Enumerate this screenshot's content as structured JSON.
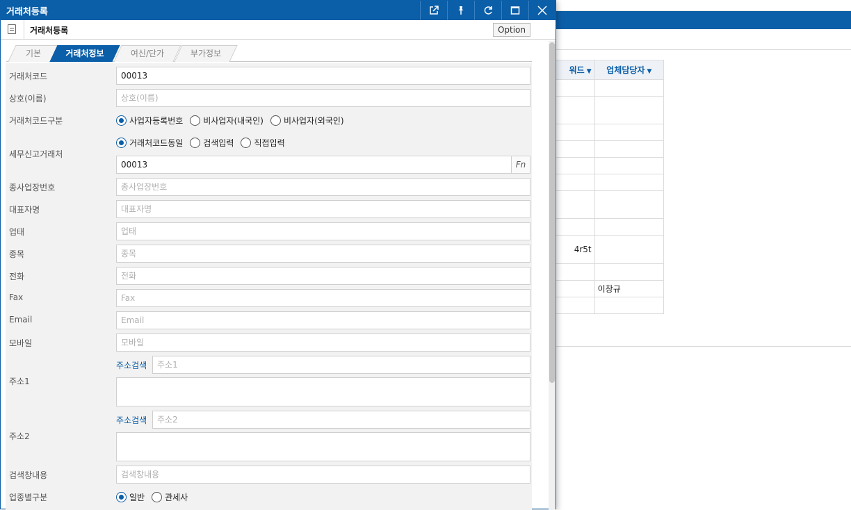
{
  "background": {
    "grid_headers": [
      "워드",
      "업체담당자"
    ],
    "grid_cells": [
      "4r5t",
      "이창규"
    ]
  },
  "dialog": {
    "title": "거래처등록",
    "header_title": "거래처등록",
    "option_label": "Option",
    "icons": [
      "popout-icon",
      "pin-icon",
      "refresh-icon",
      "maximize-icon",
      "close-icon"
    ]
  },
  "tabs": [
    "기본",
    "거래처정보",
    "여신/단가",
    "부가정보"
  ],
  "active_tab": 1,
  "form": {
    "code_label": "거래처코드",
    "code_value": "00013",
    "name_label": "상호(이름)",
    "name_placeholder": "상호(이름)",
    "code_type_label": "거래처코드구분",
    "code_type_options": [
      "사업자등록번호",
      "비사업자(내국인)",
      "비사업자(외국인)"
    ],
    "tax_label": "세무신고거래처",
    "tax_options": [
      "거래처코드동일",
      "검색입력",
      "직접입력"
    ],
    "tax_value": "00013",
    "fn_label": "Fn",
    "branch_label": "종사업장번호",
    "branch_placeholder": "종사업장번호",
    "ceo_label": "대표자명",
    "ceo_placeholder": "대표자명",
    "biz_type_label": "업태",
    "biz_type_placeholder": "업태",
    "item_label": "종목",
    "item_placeholder": "종목",
    "phone_label": "전화",
    "phone_placeholder": "전화",
    "fax_label": "Fax",
    "fax_placeholder": "Fax",
    "email_label": "Email",
    "email_placeholder": "Email",
    "mobile_label": "모바일",
    "mobile_placeholder": "모바일",
    "addr_search": "주소검색",
    "addr1_label": "주소1",
    "addr1_placeholder": "주소1",
    "addr2_label": "주소2",
    "addr2_placeholder": "주소2",
    "search_label": "검색창내용",
    "search_placeholder": "검색창내용",
    "industry_label": "업종별구분",
    "industry_options": [
      "일반",
      "관세사"
    ]
  }
}
